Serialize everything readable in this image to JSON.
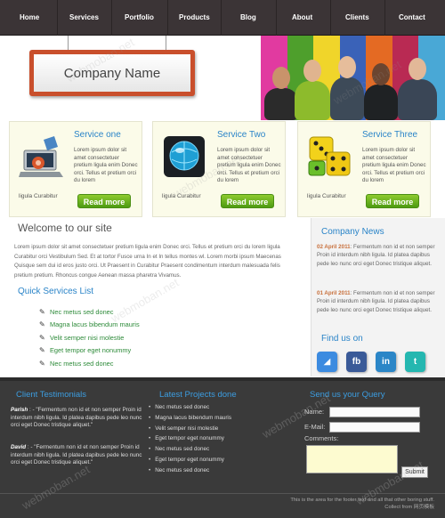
{
  "nav": {
    "items": [
      "Home",
      "Services",
      "Portfolio",
      "Products",
      "Blog",
      "About",
      "Clients",
      "Contact"
    ]
  },
  "header": {
    "sign_text": "Company Name",
    "stripe_colors": [
      "#e13aa0",
      "#4e9f2c",
      "#f0d52a",
      "#3a62b8",
      "#e46a23",
      "#b92a53",
      "#49a8d6"
    ]
  },
  "services": [
    {
      "title": "Service one",
      "text": "Lorem ipsum dolor sit amet consectetuer pretium ligula enim Donec orci. Tellus et pretium orci du lorem",
      "caption": "ligula Curabitur",
      "more": "Read more",
      "icon": "laptop-icon"
    },
    {
      "title": "Service Two",
      "text": "Lorem ipsum dolor sit amet consectetuer pretium ligula enim Donec orci. Tellus et pretium orci du lorem",
      "caption": "ligula Curabitur",
      "more": "Read more",
      "icon": "globe-icon"
    },
    {
      "title": "Service Three",
      "text": "Lorem ipsum dolor sit amet consectetuer pretium ligula enim Donec orci. Tellus et pretium orci du lorem",
      "caption": "ligula Curabitur",
      "more": "Read more",
      "icon": "dice-icon"
    }
  ],
  "welcome": {
    "title": "Welcome to our site",
    "text": "Lorem ipsum dolor sit amet consectetuer pretium ligula enim Donec orci. Tellus et pretium orci du lorem ligula Curabitur orci Vestibulum Sed. Et at tortor Fusce urna In et In tellus montes wl. Lorem morbi ipsum Maecenas Quisque sem dui id eros justo orci. Ut Praesent in Curabitur Praesent condimentum interdum malesuada felis pretium pretium. Rhoncus congue Aenean massa pharetra Vivamus."
  },
  "quick_services": {
    "title": "Quick Services List",
    "items": [
      "Nec metus sed donec",
      "Magna lacus bibendum mauris",
      "Velit semper nisi molestie",
      "Eget tempor eget nonummy",
      "Nec metus sed donec"
    ]
  },
  "news": {
    "title": "Company News",
    "items": [
      {
        "date": "02 April 2011",
        "text": ": Fermentum non id et non semper Proin id interdum nibh ligula. Id platea dapibus pede leo nunc orci eget Donec tristique aliquet."
      },
      {
        "date": "01 April 2011",
        "text": ": Fermentum non id et non semper Proin id interdum nibh ligula. Id platea dapibus pede leo nunc orci eget Donec tristique aliquet."
      }
    ]
  },
  "find_us": {
    "title": "Find us on",
    "icons": [
      {
        "name": "delicious-icon",
        "glyph": "◢",
        "color": "#3c8be0"
      },
      {
        "name": "facebook-icon",
        "glyph": "fb",
        "color": "#3a5a98"
      },
      {
        "name": "linkedin-icon",
        "glyph": "in",
        "color": "#2b86c7"
      },
      {
        "name": "twitter-icon",
        "glyph": "t",
        "color": "#25b7b0"
      }
    ]
  },
  "footer": {
    "testimonials_title": "Client Testimonials",
    "testimonials": [
      {
        "author": "Parish",
        "text": " : - \"Fermentum non id et non semper Proin id interdum nibh ligula. Id platea dapibus pede leo nunc orci eget Donec tristique aliquet.\""
      },
      {
        "author": "David",
        "text": " : - \"Fermentum non id et non semper Proin id interdum nibh ligula. Id platea dapibus pede leo nunc orci eget Donec tristique aliquet.\""
      }
    ],
    "projects_title": "Latest Projects done",
    "projects": [
      "Nec metus sed donec",
      "Magna lacus bibendum mauris",
      "Velit semper nisi molestie",
      "Eget tempor eget nonummy",
      "Nec metus sed donec",
      "Eget tempor eget nonummy",
      "Nec metus sed donec"
    ],
    "query_title": "Send us your Query",
    "name_label": "Name:",
    "email_label": "E-Mail:",
    "comments_label": "Comments:",
    "submit_label": "Submit",
    "copyright_line1": "This is the area for the footer text and all that other boring stuff.",
    "copyright_line2": "Collect from 网页模板"
  },
  "watermark": "webmoban.net"
}
